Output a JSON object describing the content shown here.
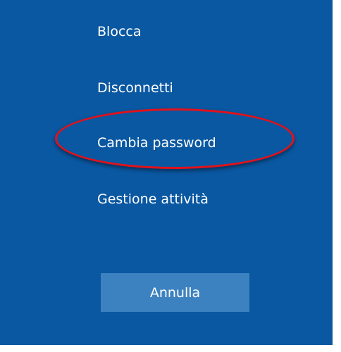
{
  "menu": {
    "items": [
      {
        "label": "Blocca"
      },
      {
        "label": "Disconnetti"
      },
      {
        "label": "Cambia password"
      },
      {
        "label": "Gestione attività"
      }
    ]
  },
  "cancel": {
    "label": "Annulla"
  },
  "colors": {
    "background": "#0a58a2",
    "button": "#3d82c0",
    "highlight": "#e3111a",
    "text": "#ffffff"
  }
}
